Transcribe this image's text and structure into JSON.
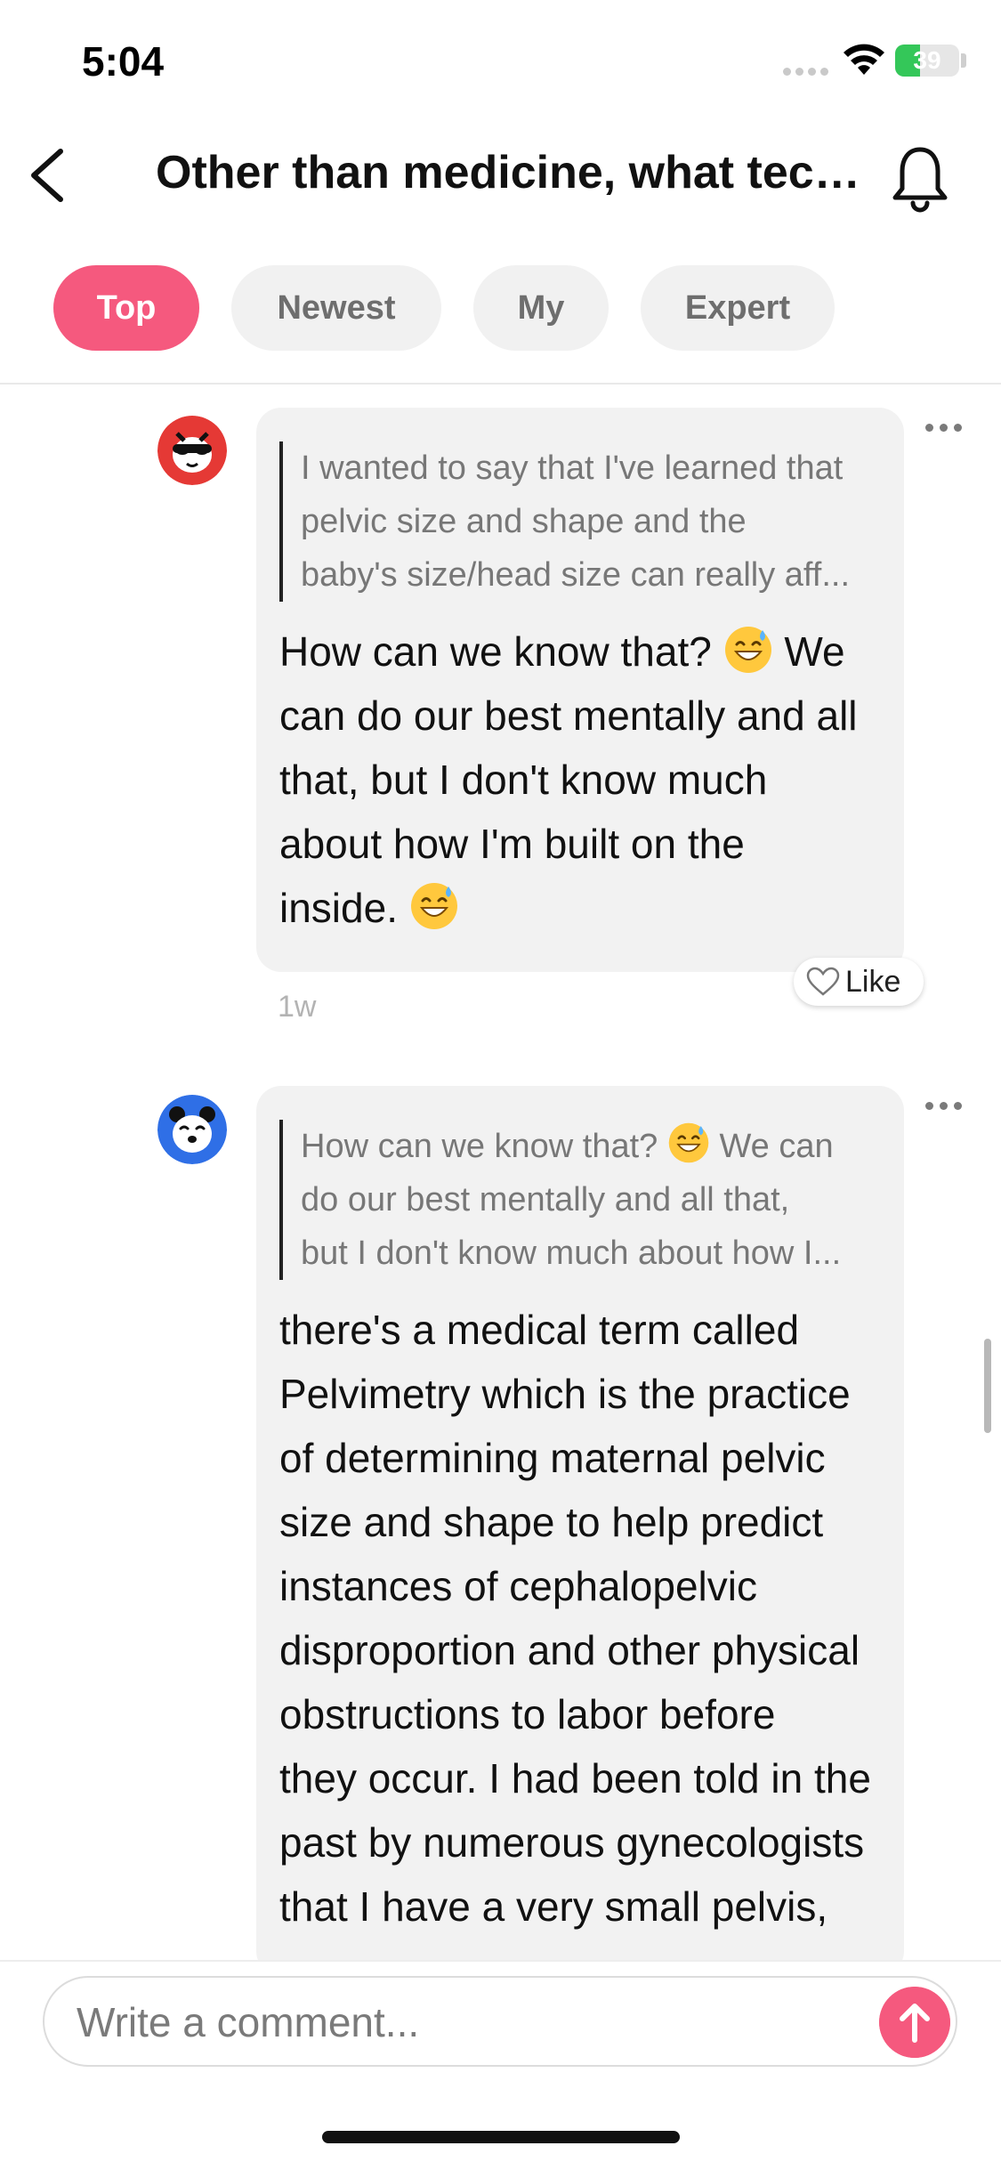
{
  "status_bar": {
    "time": "5:04",
    "battery_level": "39"
  },
  "header": {
    "title": "Other than medicine, what tech..."
  },
  "tabs": [
    {
      "label": "Top",
      "active": true
    },
    {
      "label": "Newest",
      "active": false
    },
    {
      "label": "My",
      "active": false
    },
    {
      "label": "Expert",
      "active": false
    }
  ],
  "comments": [
    {
      "quote_lines": [
        "I wanted to say that I've learned that",
        "pelvic size and shape and the",
        "baby's size/head size can really aff..."
      ],
      "body_lines": [
        "How can we know that?",
        "We",
        "can do our best mentally and all",
        "that, but I don't know much",
        "about how I'm built on the",
        "inside."
      ],
      "like_label": "Like",
      "age": "1w"
    },
    {
      "quote_lines": [
        "How can we know that?",
        "We can",
        "do our best mentally and all that,",
        "but I don't know much about how I..."
      ],
      "body_lines": [
        "there's a medical term called",
        "Pelvimetry which is the practice",
        "of determining maternal pelvic",
        "size and shape to help predict",
        "instances of cephalopelvic",
        "disproportion and other physical",
        "obstructions to labor before",
        "they occur. I had been told in the",
        "past by numerous gynecologists",
        "that I have a very small pelvis,"
      ]
    }
  ],
  "composer": {
    "placeholder": "Write a comment..."
  },
  "colors": {
    "accent": "#f5597e",
    "bubble": "#f2f2f2",
    "battery": "#34c759"
  }
}
